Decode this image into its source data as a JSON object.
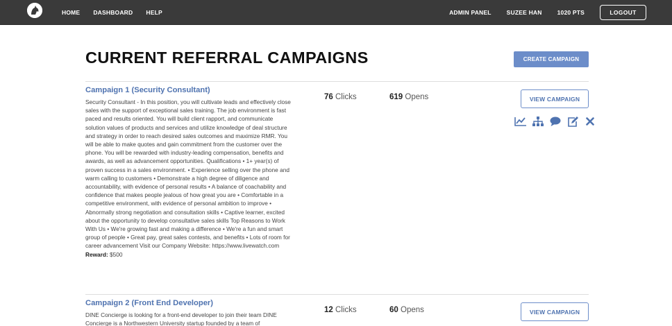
{
  "nav": {
    "left": [
      "HOME",
      "DASHBOARD",
      "HELP"
    ],
    "admin": "ADMIN PANEL",
    "user": "SUZEE HAN",
    "points": "1020 PTS",
    "logout": "LOGOUT"
  },
  "page": {
    "title": "CURRENT REFERRAL CAMPAIGNS",
    "create_button": "CREATE CAMPAIGN"
  },
  "campaigns": [
    {
      "title": "Campaign 1 (Security Consultant)",
      "description": "Security Consultant - In this position, you will cultivate leads and effectively close sales with the support of exceptional sales training. The job environment is fast paced and results oriented. You will build client rapport, and communicate solution values of products and services and utilize knowledge of deal structure and strategy in order to reach desired sales outcomes and maximize RMR. You will be able to make quotes and gain commitment from the customer over the phone. You will be rewarded with industry-leading compensation, benefits and awards, as well as advancement opportunities. Qualifications • 1+ year(s) of proven success in a sales environment. • Experience selling over the phone and warm calling to customers • Demonstrate a high degree of diligence and accountability, with evidence of personal results • A balance of coachability and confidence that makes people jealous of how great you are • Comfortable in a competitive environment, with evidence of personal ambition to improve • Abnormally strong negotiation and consultation skills • Captive learner, excited about the opportunity to develop consultative sales skills Top Reasons to Work With Us • We're growing fast and making a difference • We're a fun and smart group of people • Great pay, great sales contests, and benefits • Lots of room for career advancement Visit our Company Website: https://www.livewatch.com",
      "reward_label": "Reward:",
      "reward_value": "$500",
      "clicks": "76",
      "clicks_label": "Clicks",
      "opens": "619",
      "opens_label": "Opens",
      "view_button": "VIEW CAMPAIGN"
    },
    {
      "title": "Campaign 2 (Front End Developer)",
      "description": "DINE Concierge is looking for a front-end developer to join their team DINE Concierge is a Northwestern University startup founded by a team of",
      "clicks": "12",
      "clicks_label": "Clicks",
      "opens": "60",
      "opens_label": "Opens",
      "view_button": "VIEW CAMPAIGN"
    }
  ],
  "icons": [
    "analytics-chart-icon",
    "org-chart-icon",
    "comment-icon",
    "edit-icon",
    "delete-icon"
  ],
  "colors": {
    "navbar": "#3a3a3a",
    "accent": "#6c8dc9",
    "link": "#4f73b0"
  }
}
